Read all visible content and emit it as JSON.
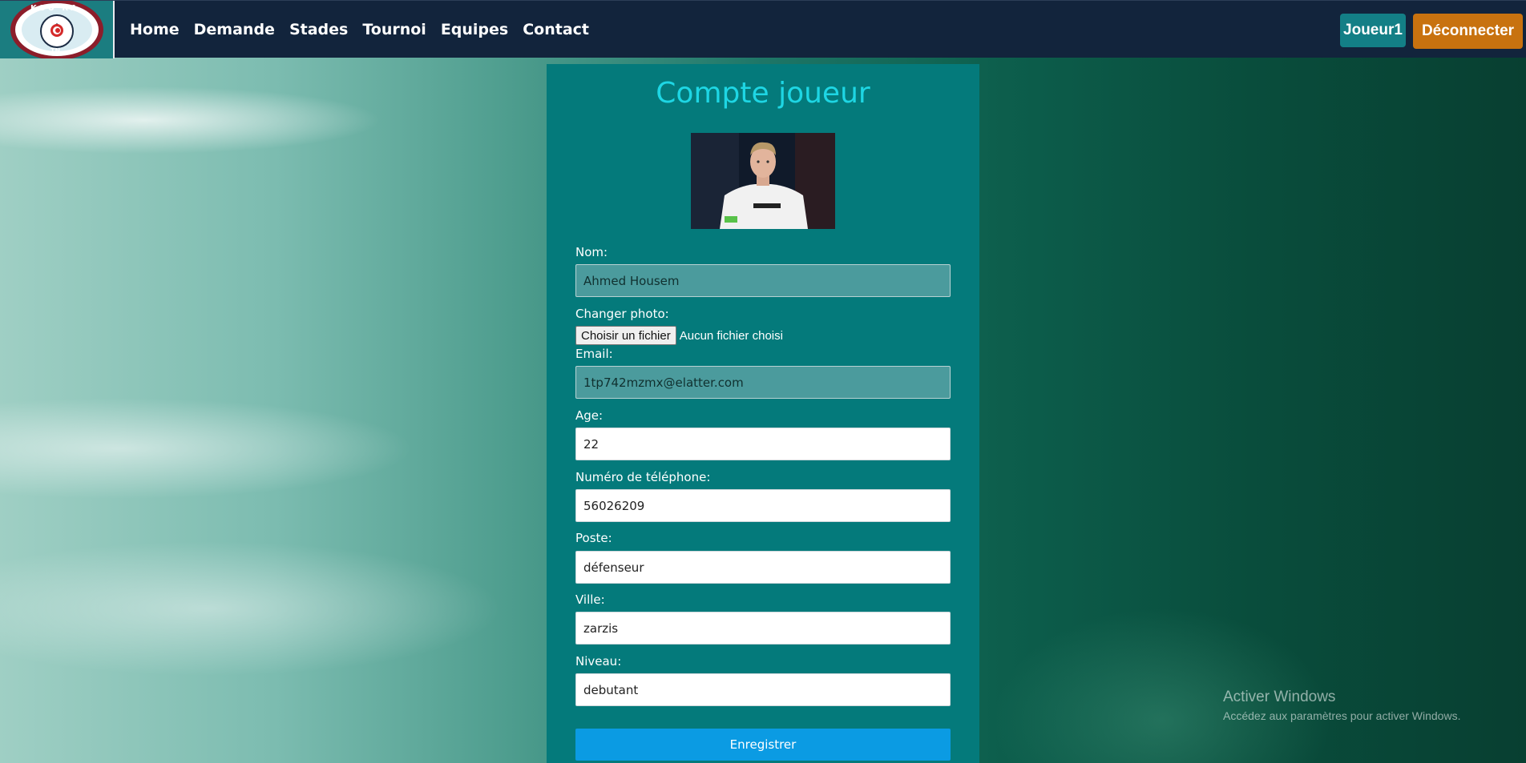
{
  "nav": {
    "logo": {
      "top_text": "KOU RA",
      "bottom_text": "TN"
    },
    "links": [
      "Home",
      "Demande",
      "Stades",
      "Tournoi",
      "Equipes",
      "Contact"
    ],
    "user_button": "Joueur1",
    "logout_button": "Déconnecter"
  },
  "form": {
    "title": "Compte joueur",
    "photo_icon": "player-photo",
    "nom": {
      "label": "Nom:",
      "value": "Ahmed Housem"
    },
    "photo": {
      "label": "Changer photo:",
      "button": "Choisir un fichier",
      "status": "Aucun fichier choisi"
    },
    "email": {
      "label": "Email:",
      "value": "1tp742mzmx@elatter.com"
    },
    "age": {
      "label": "Age:",
      "value": "22"
    },
    "telephone": {
      "label": "Numéro de téléphone:",
      "value": "56026209"
    },
    "poste": {
      "label": "Poste:",
      "value": "défenseur"
    },
    "ville": {
      "label": "Ville:",
      "value": "zarzis"
    },
    "niveau": {
      "label": "Niveau:",
      "value": "debutant"
    },
    "submit": "Enregistrer"
  },
  "watermark": {
    "title": "Activer Windows",
    "subtitle": "Accédez aux paramètres pour activer Windows."
  },
  "colors": {
    "navbar": "#12243c",
    "card": "#047a7b",
    "title": "#1ed6e4",
    "user_button": "#137f86",
    "logout_button": "#c8720f",
    "submit_button": "#0b9be3"
  }
}
